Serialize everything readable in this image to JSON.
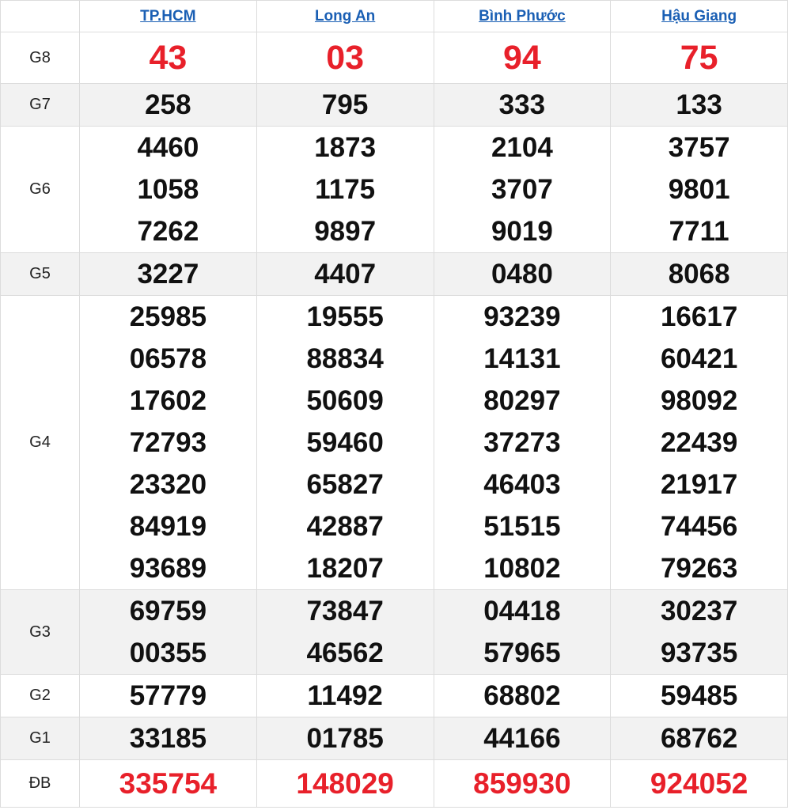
{
  "provinces": [
    "TP.HCM",
    "Long An",
    "Bình Phước",
    "Hậu Giang"
  ],
  "rows": [
    {
      "label": "G8",
      "values": [
        [
          "43"
        ],
        [
          "03"
        ],
        [
          "94"
        ],
        [
          "75"
        ]
      ]
    },
    {
      "label": "G7",
      "values": [
        [
          "258"
        ],
        [
          "795"
        ],
        [
          "333"
        ],
        [
          "133"
        ]
      ]
    },
    {
      "label": "G6",
      "values": [
        [
          "4460",
          "1058",
          "7262"
        ],
        [
          "1873",
          "1175",
          "9897"
        ],
        [
          "2104",
          "3707",
          "9019"
        ],
        [
          "3757",
          "9801",
          "7711"
        ]
      ]
    },
    {
      "label": "G5",
      "values": [
        [
          "3227"
        ],
        [
          "4407"
        ],
        [
          "0480"
        ],
        [
          "8068"
        ]
      ]
    },
    {
      "label": "G4",
      "values": [
        [
          "25985",
          "06578",
          "17602",
          "72793",
          "23320",
          "84919",
          "93689"
        ],
        [
          "19555",
          "88834",
          "50609",
          "59460",
          "65827",
          "42887",
          "18207"
        ],
        [
          "93239",
          "14131",
          "80297",
          "37273",
          "46403",
          "51515",
          "10802"
        ],
        [
          "16617",
          "60421",
          "98092",
          "22439",
          "21917",
          "74456",
          "79263"
        ]
      ]
    },
    {
      "label": "G3",
      "values": [
        [
          "69759",
          "00355"
        ],
        [
          "73847",
          "46562"
        ],
        [
          "04418",
          "57965"
        ],
        [
          "30237",
          "93735"
        ]
      ]
    },
    {
      "label": "G2",
      "values": [
        [
          "57779"
        ],
        [
          "11492"
        ],
        [
          "68802"
        ],
        [
          "59485"
        ]
      ]
    },
    {
      "label": "G1",
      "values": [
        [
          "33185"
        ],
        [
          "01785"
        ],
        [
          "44166"
        ],
        [
          "68762"
        ]
      ]
    },
    {
      "label": "ĐB",
      "values": [
        [
          "335754"
        ],
        [
          "148029"
        ],
        [
          "859930"
        ],
        [
          "924052"
        ]
      ]
    }
  ],
  "colors": {
    "highlight": "#e8202a",
    "link": "#1a5fb4",
    "alt_row": "#f2f2f2"
  }
}
